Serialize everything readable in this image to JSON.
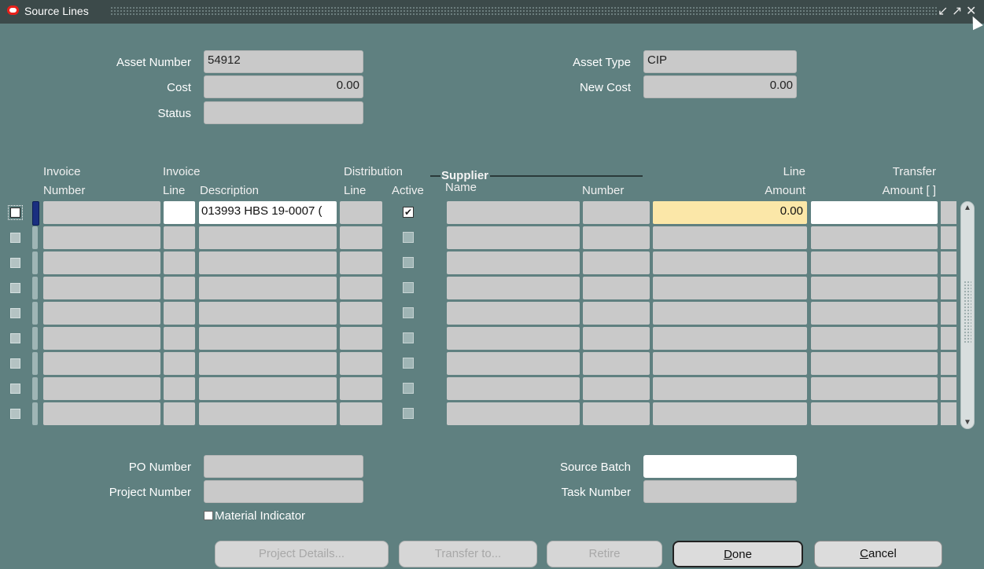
{
  "window": {
    "title": "Source Lines"
  },
  "header": {
    "asset_number_label": "Asset Number",
    "asset_number": "54912",
    "cost_label": "Cost",
    "cost": "0.00",
    "status_label": "Status",
    "status": "",
    "asset_type_label": "Asset Type",
    "asset_type": "CIP",
    "new_cost_label": "New Cost",
    "new_cost": "0.00"
  },
  "columns": {
    "invoice_number_1": "Invoice",
    "invoice_number_2": "Number",
    "invoice_line_1": "Invoice",
    "invoice_line_2": "Line",
    "description": "Description",
    "distribution_line_1": "Distribution",
    "distribution_line_2": "Line",
    "active": "Active",
    "supplier_group": "Supplier",
    "supplier_name": "Name",
    "supplier_number": "Number",
    "line_amount_1": "Line",
    "line_amount_2": "Amount",
    "transfer_amount_1": "Transfer",
    "transfer_amount_2": "Amount [ ]"
  },
  "rows": [
    {
      "description": "013993 HBS 19-0007 (",
      "active": true,
      "line_amount": "0.00"
    }
  ],
  "empty_row_count": 8,
  "footer": {
    "po_number_label": "PO Number",
    "po_number": "",
    "project_number_label": "Project Number",
    "project_number": "",
    "material_indicator_label": "Material Indicator",
    "source_batch_label": "Source Batch",
    "source_batch": "",
    "task_number_label": "Task Number",
    "task_number": ""
  },
  "buttons": {
    "project_details": "Project Details...",
    "transfer_to": "Transfer to...",
    "retire": "Retire",
    "done_mnemonic": "D",
    "done_rest": "one",
    "cancel_mnemonic": "C",
    "cancel_rest": "ancel"
  },
  "colors": {
    "background": "#5f8080",
    "field": "#c9c9c9",
    "current_field": "#fbe7a8",
    "titlebar": "#3c4a4a"
  }
}
